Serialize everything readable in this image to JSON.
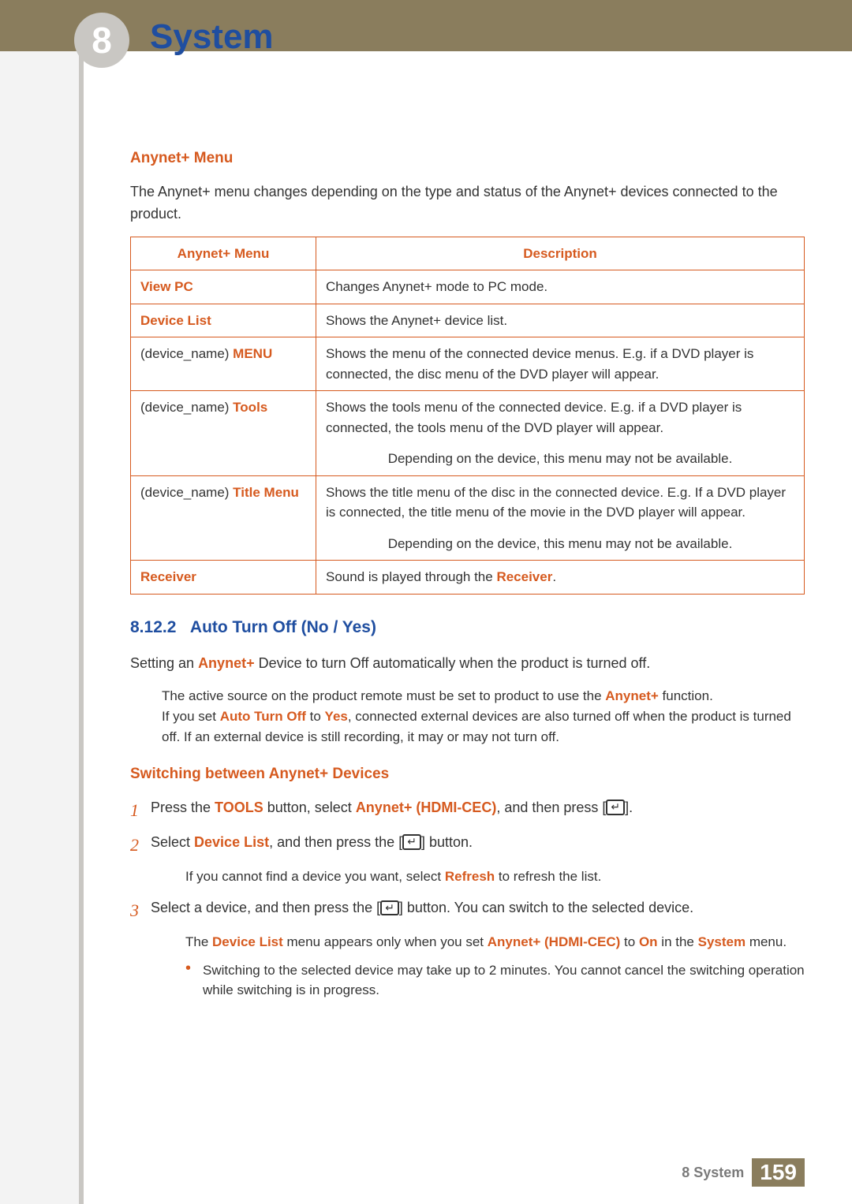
{
  "chapter_badge": "8",
  "page_title": "System",
  "section1": {
    "heading": "Anynet+ Menu",
    "intro": "The Anynet+ menu changes depending on the type and status of the Anynet+ devices connected to the product."
  },
  "table": {
    "header": {
      "c1": "Anynet+ Menu",
      "c2": "Description"
    },
    "rows": [
      {
        "label": "View PC",
        "label_prefix": "",
        "desc": "Changes Anynet+ mode to PC mode."
      },
      {
        "label": "Device List",
        "label_prefix": "",
        "desc": "Shows the Anynet+ device list."
      },
      {
        "label": "MENU",
        "label_prefix": "(device_name) ",
        "desc": "Shows the menu of the connected device menus. E.g. if a DVD player is connected, the disc menu of the DVD player will appear."
      },
      {
        "label": "Tools",
        "label_prefix": "(device_name) ",
        "desc": "Shows the tools menu of the connected device. E.g. if a DVD player is connected, the tools menu of the DVD player will appear.",
        "note": "Depending on the device, this menu may not be available."
      },
      {
        "label": "Title Menu",
        "label_prefix": "(device_name) ",
        "desc": "Shows the title menu of the disc in the connected device. E.g. If a DVD player is connected, the title menu of the movie in the DVD player will appear.",
        "note": "Depending on the device, this menu may not be available."
      },
      {
        "label": "Receiver",
        "label_prefix": "",
        "desc_pre": "Sound is played through the ",
        "desc_kw": "Receiver",
        "desc_post": "."
      }
    ]
  },
  "section2": {
    "num": "8.12.2",
    "title": "Auto Turn Off (No / Yes)",
    "line_pre": "Setting an ",
    "line_kw": "Anynet+",
    "line_post": " Device to turn Off automatically when the product is turned off.",
    "note_l1_pre": "The active source on the product remote must be set to product to use the ",
    "note_l1_kw": "Anynet+",
    "note_l1_post": " function.",
    "note_l2_pre": "If you set ",
    "note_l2_kw1": "Auto Turn Off",
    "note_l2_mid": " to ",
    "note_l2_kw2": "Yes",
    "note_l2_post": ", connected external devices are also turned off when the product is turned off. If an external device is still recording, it may or may not turn off."
  },
  "section3": {
    "heading": "Switching between Anynet+ Devices",
    "steps": {
      "1": {
        "pre": "Press the ",
        "kw1": "TOOLS",
        "mid": " button, select ",
        "kw2": "Anynet+ (HDMI-CEC)",
        "post": ", and then press [",
        "tail": "]."
      },
      "2": {
        "pre": "Select ",
        "kw1": "Device List",
        "mid": ", and then press the [",
        "post": "] button."
      },
      "2_note": {
        "pre": "If you cannot find a device you want, select ",
        "kw": "Refresh",
        "post": " to refresh the list."
      },
      "3": {
        "pre": "Select a device, and then press the [",
        "post": "] button. You can switch to the selected device."
      },
      "3_note": {
        "pre": "The ",
        "kw1": "Device List",
        "mid1": " menu appears only when you set ",
        "kw2": "Anynet+ (HDMI-CEC)",
        "mid2": " to ",
        "kw3": "On",
        "mid3": " in the ",
        "kw4": "System",
        "post": " menu."
      },
      "3_bullet": "Switching to the selected device may take up to 2 minutes. You cannot cancel the switching operation while switching is in progress."
    }
  },
  "enter_glyph": "↵",
  "footer": {
    "label": "8 System",
    "page": "159"
  }
}
